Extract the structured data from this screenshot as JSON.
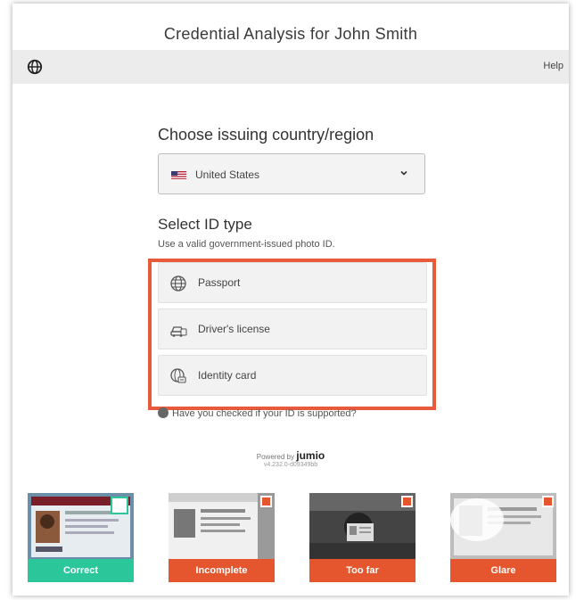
{
  "header": {
    "title": "Credential Analysis for John Smith",
    "help_label": "Help"
  },
  "country": {
    "heading": "Choose issuing country/region",
    "selected": "United States"
  },
  "id_type": {
    "heading": "Select ID type",
    "subtitle": "Use a valid government-issued photo ID.",
    "options": [
      {
        "label": "Passport",
        "icon": "globe-icon"
      },
      {
        "label": "Driver's license",
        "icon": "car-icon"
      },
      {
        "label": "Identity card",
        "icon": "id-card-icon"
      }
    ]
  },
  "support_link": "Have you checked if your ID is supported?",
  "footer": {
    "powered_by": "Powered by",
    "brand": "jumio",
    "version": "v4.232.0-d09349bb"
  },
  "examples": [
    {
      "label": "Correct",
      "status": "good"
    },
    {
      "label": "Incomplete",
      "status": "bad"
    },
    {
      "label": "Too far",
      "status": "bad"
    },
    {
      "label": "Glare",
      "status": "bad"
    }
  ],
  "colors": {
    "highlight": "#e85a3c",
    "correct": "#2bc79a",
    "bad": "#e5562f"
  }
}
